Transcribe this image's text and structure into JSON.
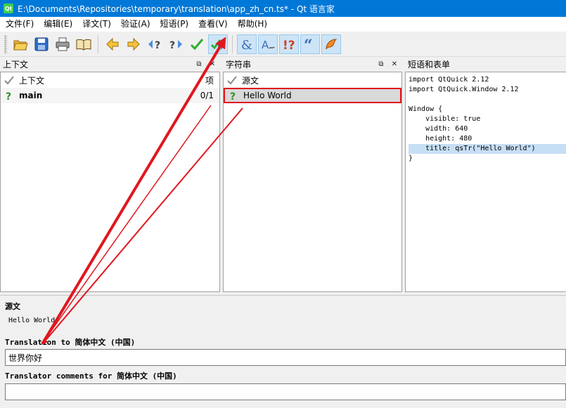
{
  "window": {
    "title": "E:\\Documents\\Repositories\\temporary\\translation\\app_zh_cn.ts* - Qt 语言家",
    "app_icon_text": "Qt"
  },
  "menu": [
    {
      "label": "文件(F)"
    },
    {
      "label": "编辑(E)"
    },
    {
      "label": "译文(T)"
    },
    {
      "label": "验证(A)"
    },
    {
      "label": "短语(P)"
    },
    {
      "label": "查看(V)"
    },
    {
      "label": "帮助(H)"
    }
  ],
  "toolbar": {
    "icons": [
      "open-icon",
      "save-icon",
      "print-icon",
      "phrasebook-icon",
      "prev-icon",
      "next-icon",
      "prev-unfinished-icon",
      "next-unfinished-icon",
      "done-icon",
      "done-and-next-icon",
      "accelerator-check-icon",
      "punctuation-check-icon",
      "phrase-check-icon",
      "placemarker-check-icon",
      "length-check-icon"
    ]
  },
  "context_panel": {
    "title": "上下文",
    "header_row": {
      "label": "上下文",
      "count": "项"
    },
    "rows": [
      {
        "label": "main",
        "count": "0/1"
      }
    ]
  },
  "strings_panel": {
    "title": "字符串",
    "header_row": {
      "label": "源文"
    },
    "rows": [
      {
        "label": "Hello World"
      }
    ]
  },
  "phrases_panel": {
    "title": "短语和表单",
    "code_lines": [
      "import QtQuick 2.12",
      "import QtQuick.Window 2.12",
      "",
      "Window {",
      "    visible: true",
      "    width: 640",
      "    height: 480",
      "    title: qsTr(\"Hello World\")",
      "}"
    ],
    "highlight_line": 7
  },
  "editor": {
    "source_label": "源文",
    "source_text": "Hello World",
    "translation_label": "Translation to 简体中文 (中国)",
    "translation_value": "世界你好",
    "comments_label": "Translator comments for 简体中文 (中国)",
    "comments_value": ""
  },
  "colors": {
    "titlebar": "#0078d7",
    "annotation_red": "#e0171e",
    "highlight": "#c7dff5"
  }
}
